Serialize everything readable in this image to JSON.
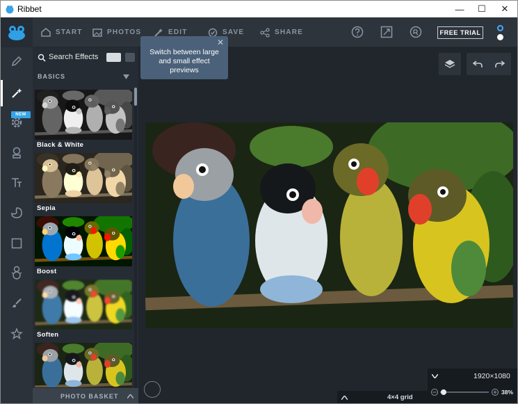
{
  "window": {
    "title": "Ribbet",
    "minimize": "—",
    "maximize": "☐",
    "close": "✕"
  },
  "toolbar": {
    "tabs": [
      {
        "label": "START",
        "icon": "home-icon"
      },
      {
        "label": "PHOTOS",
        "icon": "photo-icon"
      },
      {
        "label": "EDIT",
        "icon": "magic-wand-icon"
      },
      {
        "label": "SAVE",
        "icon": "check-circle-icon"
      },
      {
        "label": "SHARE",
        "icon": "share-icon"
      }
    ],
    "free_trial": "FREE TRIAL",
    "dot_colors": {
      "top": "#4aa8ff",
      "bottom": "#ffffff"
    }
  },
  "rail": {
    "icons": [
      "pencil-icon",
      "magic-wand-icon",
      "gear-icon",
      "stamp-icon",
      "text-icon",
      "palette-icon",
      "frame-icon",
      "snowman-icon",
      "brush-icon",
      "star-icon"
    ],
    "new_badge": "NEW"
  },
  "panel": {
    "search_label": "Search Effects",
    "section": "BASICS",
    "effects": [
      {
        "name": "Black & White"
      },
      {
        "name": "Sepia"
      },
      {
        "name": "Boost"
      },
      {
        "name": "Soften"
      },
      {
        "name": ""
      }
    ],
    "basket": "PHOTO BASKET"
  },
  "tooltip": {
    "text_lines": [
      "Switch between large",
      "and small effect",
      "previews"
    ]
  },
  "canvas": {
    "image_size": "1920×1080",
    "zoom": "38%",
    "grid": "4×4 grid"
  },
  "colors": {
    "accent": "#35a4e8",
    "tooltip": "#4a6179",
    "toolbar": "#2d343c"
  }
}
